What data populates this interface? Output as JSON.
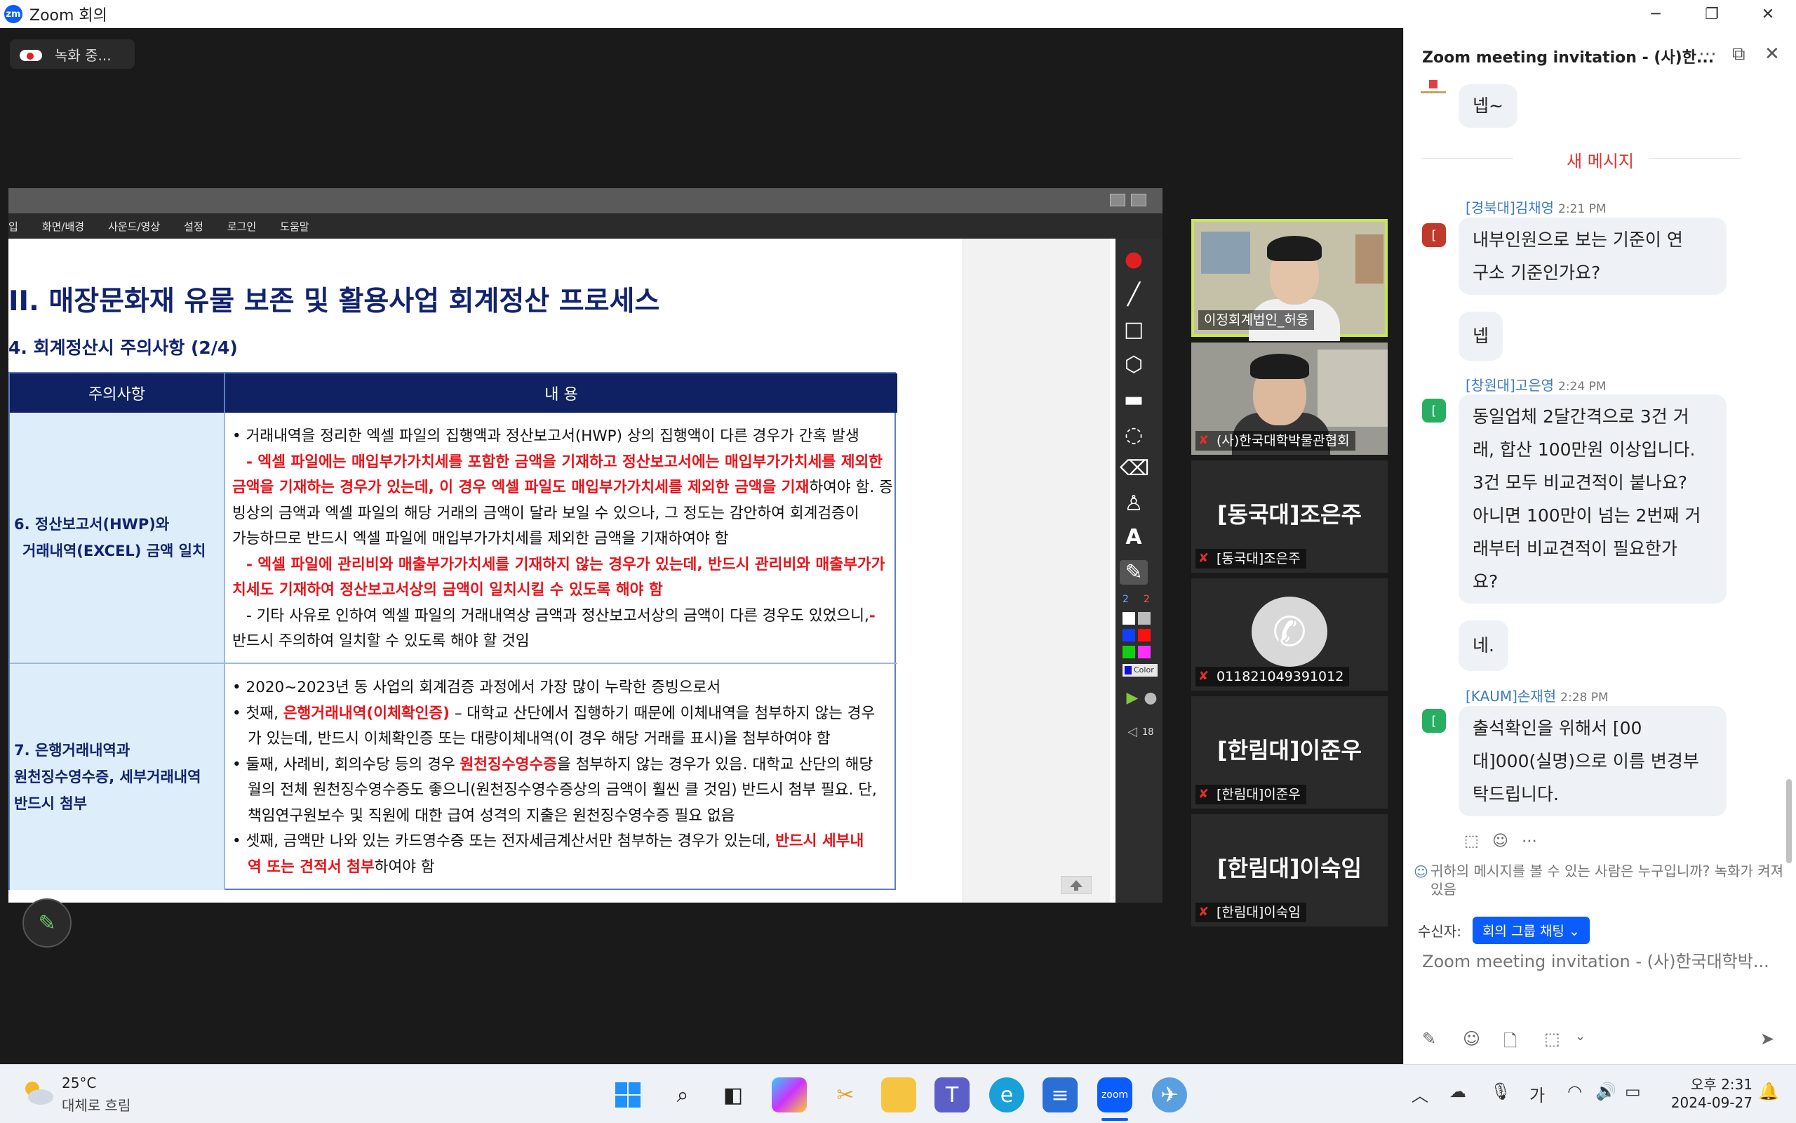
{
  "window": {
    "app_logo": "zm",
    "title": "Zoom 회의"
  },
  "meeting": {
    "recording_label": "녹화 중..."
  },
  "share": {
    "menu": [
      "입",
      "화면/배경",
      "사운드/영상",
      "설정",
      "로그인",
      "도움말"
    ],
    "slide": {
      "title": "II. 매장문화재 유물 보존 및 활용사업 회계정산 프로세스",
      "subtitle": "4. 회계정산시 주의사항 (2/4)",
      "table_headers": [
        "주의사항",
        "내 용"
      ],
      "row1_label_lines": [
        "6. 정산보고서(HWP)와",
        "거래내역(EXCEL) 금액 일치"
      ],
      "row1_lines": [
        "• 거래내역을 정리한 엑셀 파일의 집행액과 정산보고서(HWP) 상의 집행액이 다른 경우가 간혹 발생",
        "- 엑셀 파일에는 매입부가가치세를 포함한 금액을 기재하고 정산보고서에는 매입부가가치세를 제외한",
        "금액을 기재하는 경우가 있는데, 이 경우 엑셀 파일도 매입부가가치세를 제외한 금액을 기재",
        "하여야 함. 증",
        "빙상의 금액과 엑셀 파일의 해당 거래의 금액이 달라 보일 수 있으나, 그 정도는 감안하여 회계검증이",
        "가능하므로 반드시 엑셀 파일에 매입부가가치세를 제외한 금액을 기재하여야 함",
        "- 엑셀 파일에 관리비와 매출부가가치세를 기재하지 않는 경우가 있는데, 반드시 관리비와 매출부가가",
        "치세도 기재하여 정산보고서상의 금액이 일치시킬 수 있도록 해야 함",
        "- 기타 사유로 인하여 엑셀 파일의 거래내역상 금액과 정산보고서상의 금액이 다른 경우도 있었으니,",
        "-",
        "반드시 주의하여 일치할 수 있도록 해야 할 것임"
      ],
      "row2_label_lines": [
        "7. 은행거래내역과",
        "원천징수영수증, 세부거래내역",
        "반드시 첨부"
      ],
      "row2_lines": [
        "• 2020~2023년 동 사업의 회계검증 과정에서 가장 많이 누락한 증빙으로서",
        "• 첫째, ",
        "은행거래내역(이체확인증)",
        " – 대학교 산단에서 집행하기 때문에 이체내역을 첨부하지 않는 경우",
        "가 있는데, 반드시 이체확인증 또는 대량이체내역(이 경우 해당 거래를 표시)을 첨부하여야 함",
        "• 둘째, 사례비, 회의수당 등의 경우 ",
        "원천징수영수증",
        "을 첨부하지 않는 경우가 있음. 대학교 산단의 해당",
        "월의 전체 원천징수영수증도 좋으니(원천징수영수증상의 금액이 훨씬 클 것임) 반드시 첨부 필요. 단,",
        "책임연구원보수  및 직원에 대한 급여 성격의 지출은 원천징수영수증  필요 없음",
        "• 셋째, 금액만 나와 있는 카드영수증 또는 전자세금계산서만 첨부하는 경우가 있는데, ",
        "반드시 세부내",
        "역 또는 견적서 첨부",
        "하여야 함"
      ],
      "toolbar_numbers": [
        "2",
        "2",
        "18"
      ],
      "color_label": "Color"
    }
  },
  "participants": [
    {
      "name": "이정회계법인_허웅",
      "muted": false,
      "type": "video"
    },
    {
      "name": "(사)한국대학박물관협회",
      "muted": true,
      "type": "video"
    },
    {
      "name": "[동국대]조은주",
      "muted": true,
      "type": "name"
    },
    {
      "name": "011821049391012",
      "muted": true,
      "type": "phone"
    },
    {
      "name": "[한림대]이준우",
      "muted": true,
      "type": "name"
    },
    {
      "name": "[한림대]이숙임",
      "muted": true,
      "type": "name"
    }
  ],
  "chat": {
    "title": "Zoom meeting invitation - (사)한...",
    "new_messages_label": "새 메시지",
    "messages": [
      {
        "sender": "",
        "time": "",
        "lines": [
          "넵~"
        ]
      },
      {
        "sender": "[경북대]김채영",
        "time": "2:21 PM",
        "lines": [
          "내부인원으로 보는 기준이 연",
          "구소 기준인가요?"
        ]
      },
      {
        "sender": "",
        "time": "",
        "lines": [
          "넵"
        ]
      },
      {
        "sender": "[창원대]고은영",
        "time": "2:24 PM",
        "lines": [
          "동일업체 2달간격으로 3건 거",
          "래, 합산 100만원 이상입니다.",
          "3건 모두 비교견적이 붙나요?",
          "아니면 100만이 넘는 2번째 거",
          "래부터 비교견적이 필요한가",
          "요?"
        ]
      },
      {
        "sender": "",
        "time": "",
        "lines": [
          "네."
        ]
      },
      {
        "sender": "[KAUM]손재현",
        "time": "2:28 PM",
        "lines": [
          "출석확인을 위해서 [00",
          "대]000(실명)으로 이름 변경부",
          "탁드립니다."
        ]
      }
    ],
    "privacy_notice": "귀하의 메시지를 볼 수 있는 사람은 누구입니까? 녹화가 켜져 있음",
    "recipient_label": "수신자:",
    "recipient_value": "회의 그룹 채팅",
    "input_placeholder": "Zoom meeting invitation - (사)한국대학박..."
  },
  "taskbar": {
    "weather_temp": "25°C",
    "weather_desc": "대체로 흐림",
    "ime": "가",
    "time": "오후 2:31",
    "date": "2024-09-27"
  }
}
